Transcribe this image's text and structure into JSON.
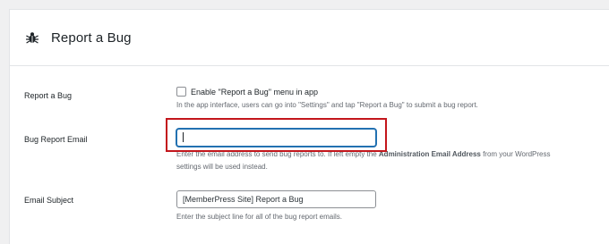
{
  "section": {
    "title": "Report a Bug",
    "icon": "bug-icon"
  },
  "rows": {
    "report_bug": {
      "label": "Report a Bug",
      "checkbox_label": "Enable \"Report a Bug\" menu in app",
      "checked": false,
      "description": "In the app interface, users can go into \"Settings\" and tap \"Report a Bug\" to submit a bug report."
    },
    "bug_email": {
      "label": "Bug Report Email",
      "value": "",
      "desc_part1": "Enter the email address to send bug reports to. If left empty the ",
      "desc_bold": "Administration Email Address",
      "desc_part2": " from your WordPress",
      "desc_line2": "settings will be used instead."
    },
    "email_subject": {
      "label": "Email Subject",
      "value": "[MemberPress Site] Report a Bug",
      "description": "Enter the subject line for all of the bug report emails."
    }
  },
  "colors": {
    "accent": "#2271b1",
    "highlight": "#c3161c",
    "description": "#646970"
  }
}
